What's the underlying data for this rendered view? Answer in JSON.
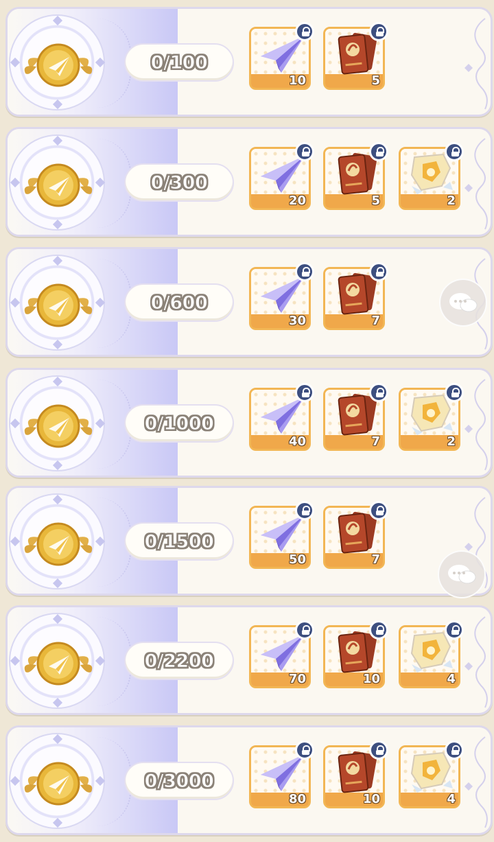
{
  "milestones": [
    {
      "progress": "0/100",
      "rewards": [
        {
          "icon": "paper-plane",
          "count": "10"
        },
        {
          "icon": "red-card-book",
          "count": "5"
        }
      ]
    },
    {
      "progress": "0/300",
      "rewards": [
        {
          "icon": "paper-plane",
          "count": "20"
        },
        {
          "icon": "red-card-book",
          "count": "5"
        },
        {
          "icon": "crystal-shard",
          "count": "2"
        }
      ]
    },
    {
      "progress": "0/600",
      "rewards": [
        {
          "icon": "paper-plane",
          "count": "30"
        },
        {
          "icon": "red-card-book",
          "count": "7"
        }
      ]
    },
    {
      "progress": "0/1000",
      "rewards": [
        {
          "icon": "paper-plane",
          "count": "40"
        },
        {
          "icon": "red-card-book",
          "count": "7"
        },
        {
          "icon": "crystal-shard",
          "count": "2"
        }
      ]
    },
    {
      "progress": "0/1500",
      "rewards": [
        {
          "icon": "paper-plane",
          "count": "50"
        },
        {
          "icon": "red-card-book",
          "count": "7"
        }
      ]
    },
    {
      "progress": "0/2200",
      "rewards": [
        {
          "icon": "paper-plane",
          "count": "70"
        },
        {
          "icon": "red-card-book",
          "count": "10"
        },
        {
          "icon": "crystal-shard",
          "count": "4"
        }
      ]
    },
    {
      "progress": "0/3000",
      "rewards": [
        {
          "icon": "paper-plane",
          "count": "80"
        },
        {
          "icon": "red-card-book",
          "count": "10"
        },
        {
          "icon": "crystal-shard",
          "count": "4"
        }
      ]
    }
  ],
  "colors": {
    "panel_bg": "#fbf8f1",
    "lavender": "#c9c8f6",
    "reward_border": "#f2b654",
    "lock_badge": "#3d4f80",
    "coin_gold": "#e8b73a"
  },
  "floating_buttons": [
    {
      "icon": "chat-bubble-icon"
    },
    {
      "icon": "chat-bubble-icon"
    }
  ]
}
